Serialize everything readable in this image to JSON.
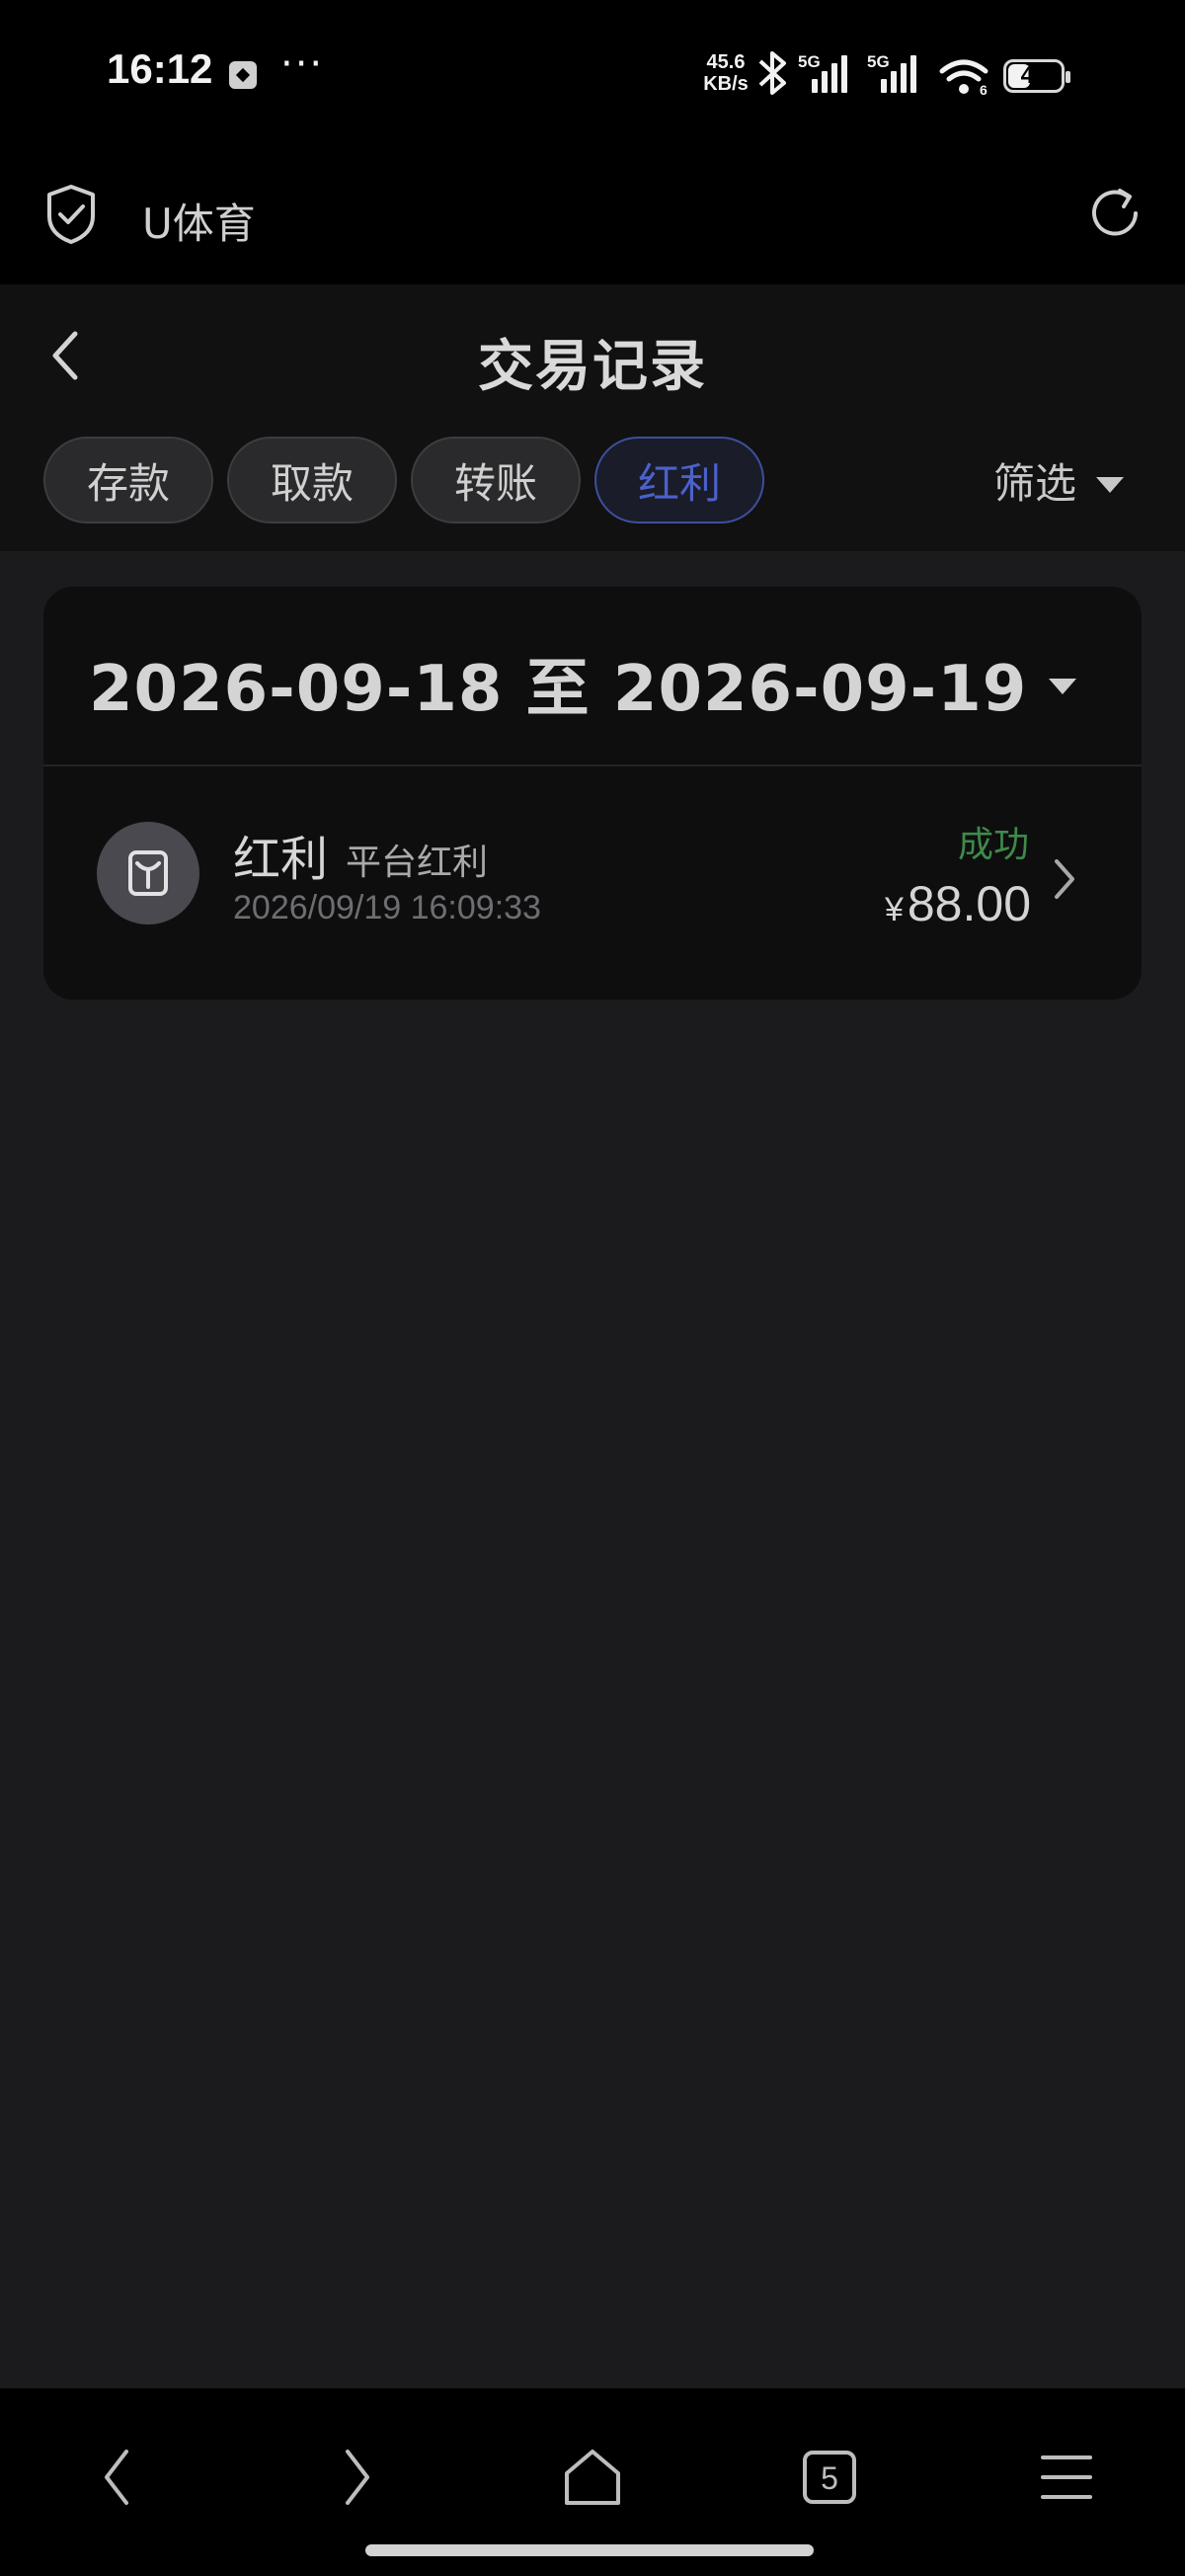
{
  "status_bar": {
    "time": "16:12",
    "more": "···",
    "speed_value": "45.6",
    "speed_unit": "KB/s",
    "network_1": "5G",
    "network_2": "5G",
    "wifi_badge": "6",
    "battery_level": "41"
  },
  "site": {
    "title": "U体育",
    "icons": [
      "shield-check-icon",
      "refresh-icon"
    ]
  },
  "header": {
    "title": "交易记录",
    "back_icon": "chevron-left-icon"
  },
  "tabs": [
    {
      "label": "存款",
      "active": false
    },
    {
      "label": "取款",
      "active": false
    },
    {
      "label": "转账",
      "active": false
    },
    {
      "label": "红利",
      "active": true
    }
  ],
  "filter": {
    "label": "筛选"
  },
  "date_range": {
    "label": "2026-09-18 至 2026-09-19"
  },
  "records": [
    {
      "type": "红利",
      "subtype": "平台红利",
      "time": "2026/09/19 16:09:33",
      "status": "成功",
      "currency": "¥",
      "amount": "88.00"
    }
  ],
  "bottom_nav": {
    "tabs_count": "5",
    "icons": [
      "back-icon",
      "forward-icon",
      "home-icon",
      "tabs-icon",
      "menu-icon"
    ]
  },
  "colors": {
    "accent": "#4c61c9",
    "success": "#3f8a4b",
    "background": "#1b1b1d"
  }
}
